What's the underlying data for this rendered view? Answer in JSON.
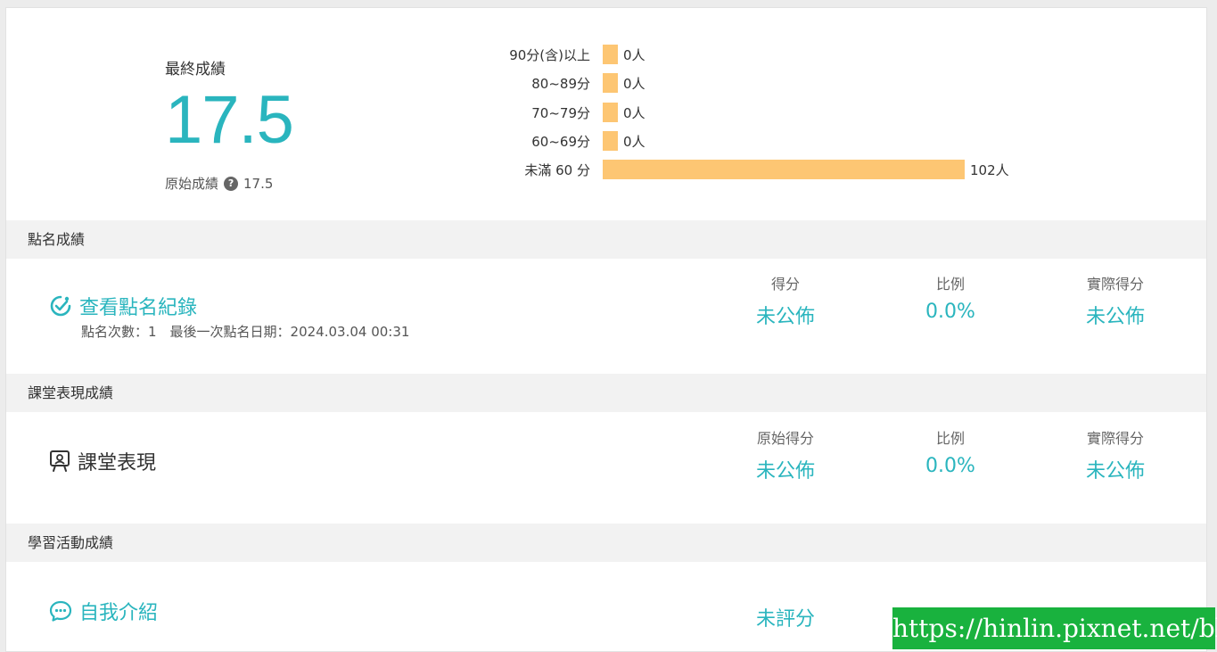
{
  "summary": {
    "final_label": "最終成績",
    "final_score": "17.5",
    "raw_label": "原始成績",
    "raw_score": "17.5",
    "help_icon": "?"
  },
  "distribution": [
    {
      "label": "90分(含)以上",
      "count": 0,
      "count_label": "0人"
    },
    {
      "label": "80~89分",
      "count": 0,
      "count_label": "0人"
    },
    {
      "label": "70~79分",
      "count": 0,
      "count_label": "0人"
    },
    {
      "label": "60~69分",
      "count": 0,
      "count_label": "0人"
    },
    {
      "label": "未滿 60 分",
      "count": 102,
      "count_label": "102人"
    }
  ],
  "attendance": {
    "header": "點名成績",
    "title": "查看點名紀錄",
    "detail": "點名次數：1　最後一次點名日期：2024.03.04 00:31",
    "cols": [
      {
        "head": "得分",
        "value": "未公佈"
      },
      {
        "head": "比例",
        "value": "0.0%"
      },
      {
        "head": "實際得分",
        "value": "未公佈"
      }
    ]
  },
  "performance": {
    "header": "課堂表現成績",
    "title": "課堂表現",
    "cols": [
      {
        "head": "原始得分",
        "value": "未公佈"
      },
      {
        "head": "比例",
        "value": "0.0%"
      },
      {
        "head": "實際得分",
        "value": "未公佈"
      }
    ]
  },
  "activities": {
    "header": "學習活動成績",
    "title": "自我介紹",
    "value": "未評分"
  },
  "watermark": "https://hinlin.pixnet.net/blog",
  "colors": {
    "accent": "#2ab5be",
    "bar": "#fdc673",
    "watermark_bg": "#19b23e"
  }
}
